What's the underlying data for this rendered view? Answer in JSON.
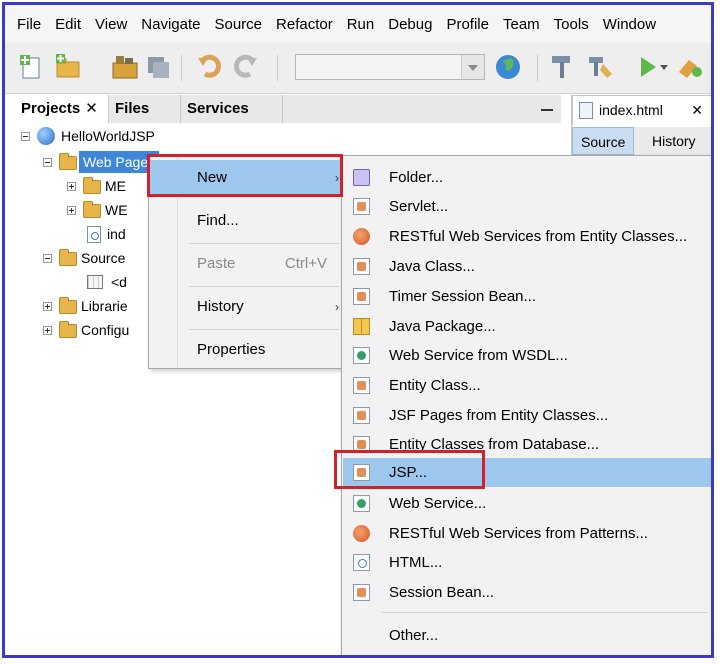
{
  "menubar": [
    "File",
    "Edit",
    "View",
    "Navigate",
    "Source",
    "Refactor",
    "Run",
    "Debug",
    "Profile",
    "Team",
    "Tools",
    "Window"
  ],
  "panel": {
    "tabs": [
      {
        "label": "Projects",
        "close": "✕"
      },
      {
        "label": "Files"
      },
      {
        "label": "Services"
      }
    ]
  },
  "tree": {
    "project": "HelloWorldJSP",
    "web_pages": "Web Pages",
    "meta": "ME",
    "web": "WE",
    "index": "ind",
    "source": "Source",
    "default_pkg": "<d",
    "libraries": "Librarie",
    "configuration": "Configu"
  },
  "editor": {
    "tab_label": "index.html",
    "tab_close": "✕",
    "subtabs": [
      "Source",
      "History"
    ]
  },
  "context_menu": {
    "items": [
      {
        "label": "New",
        "arrow": "›"
      },
      {
        "label": "Find..."
      },
      {
        "label": "Paste",
        "shortcut": "Ctrl+V"
      },
      {
        "label": "History",
        "arrow": "›"
      },
      {
        "label": "Properties"
      }
    ]
  },
  "submenu": {
    "items": [
      {
        "label": "Folder...",
        "icon": "folder-icon"
      },
      {
        "label": "Servlet...",
        "icon": "servlet-icon"
      },
      {
        "label": "RESTful Web Services from Entity Classes...",
        "icon": "restful-icon"
      },
      {
        "label": "Java Class...",
        "icon": "java-class-icon"
      },
      {
        "label": "Timer Session Bean...",
        "icon": "session-bean-icon"
      },
      {
        "label": "Java Package...",
        "icon": "java-package-icon"
      },
      {
        "label": "Web Service from WSDL...",
        "icon": "web-service-icon"
      },
      {
        "label": "Entity Class...",
        "icon": "entity-class-icon"
      },
      {
        "label": "JSF Pages from Entity Classes...",
        "icon": "jsf-pages-icon"
      },
      {
        "label": "Entity Classes from Database...",
        "icon": "entity-db-icon"
      },
      {
        "label": "JSP...",
        "icon": "jsp-icon"
      },
      {
        "label": "Web Service...",
        "icon": "web-service-icon"
      },
      {
        "label": "RESTful Web Services from Patterns...",
        "icon": "restful-icon"
      },
      {
        "label": "HTML...",
        "icon": "html-file-icon"
      },
      {
        "label": "Session Bean...",
        "icon": "session-bean-icon"
      },
      {
        "label": "Other..."
      }
    ]
  },
  "colors": {
    "highlight": "#9ec7ee",
    "selection": "#3d86d8",
    "annotation": "#d3202a",
    "frame": "#3b3bc8"
  }
}
